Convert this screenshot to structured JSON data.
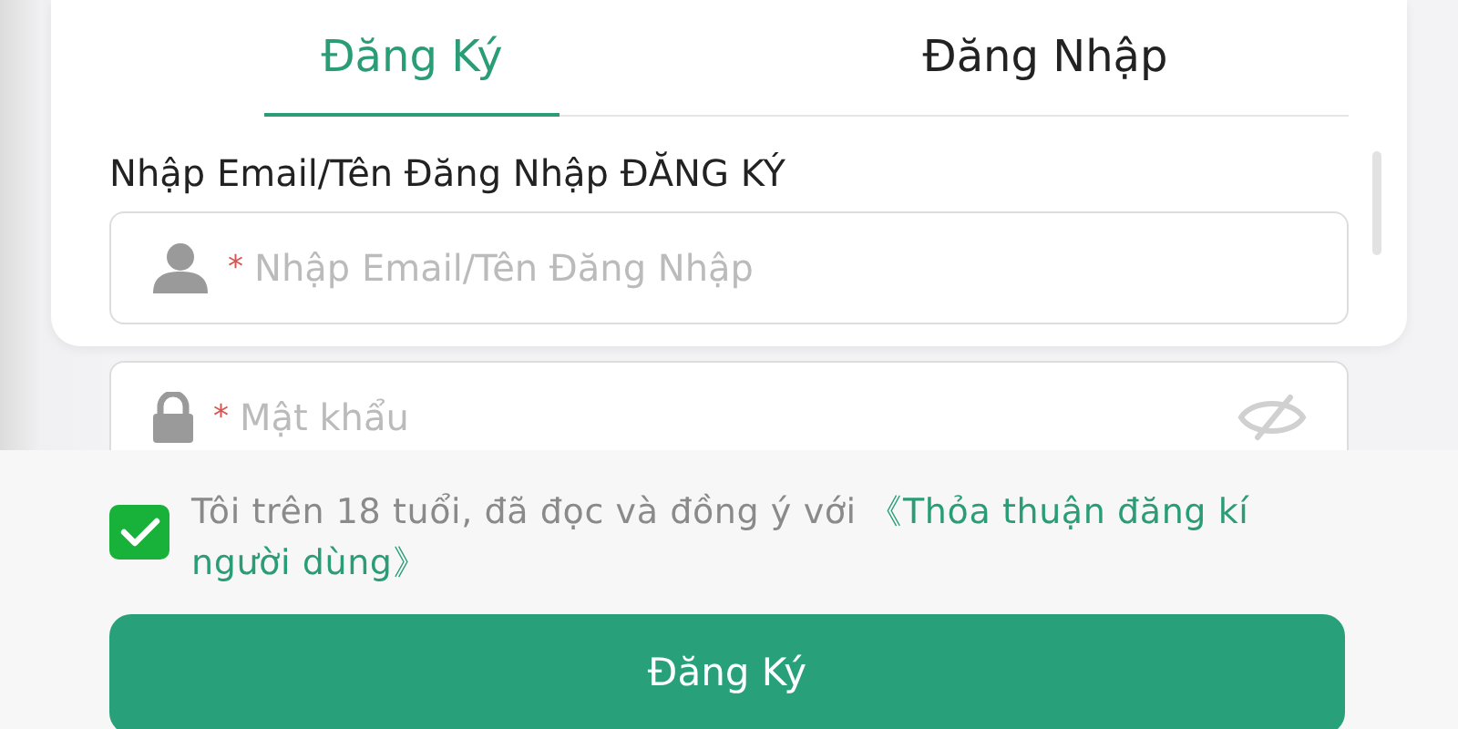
{
  "tabs": [
    {
      "label": "Đăng Ký",
      "selected": true
    },
    {
      "label": "Đăng Nhập",
      "selected": false
    }
  ],
  "fields": [
    {
      "kind": "user",
      "label": "Nhập Email/Tên Đăng Nhập ĐĂNG KÝ",
      "required_mark": "*",
      "placeholder": "Nhập Email/Tên Đăng Nhập"
    },
    {
      "kind": "password",
      "required_mark": "*",
      "placeholder": "Mật khẩu"
    }
  ],
  "agreement": {
    "checked": true,
    "text": "Tôi trên 18 tuổi, đã đọc và đồng ý với",
    "link": "《Thỏa thuận đăng kí người dùng》"
  },
  "submit": "Đăng Ký"
}
